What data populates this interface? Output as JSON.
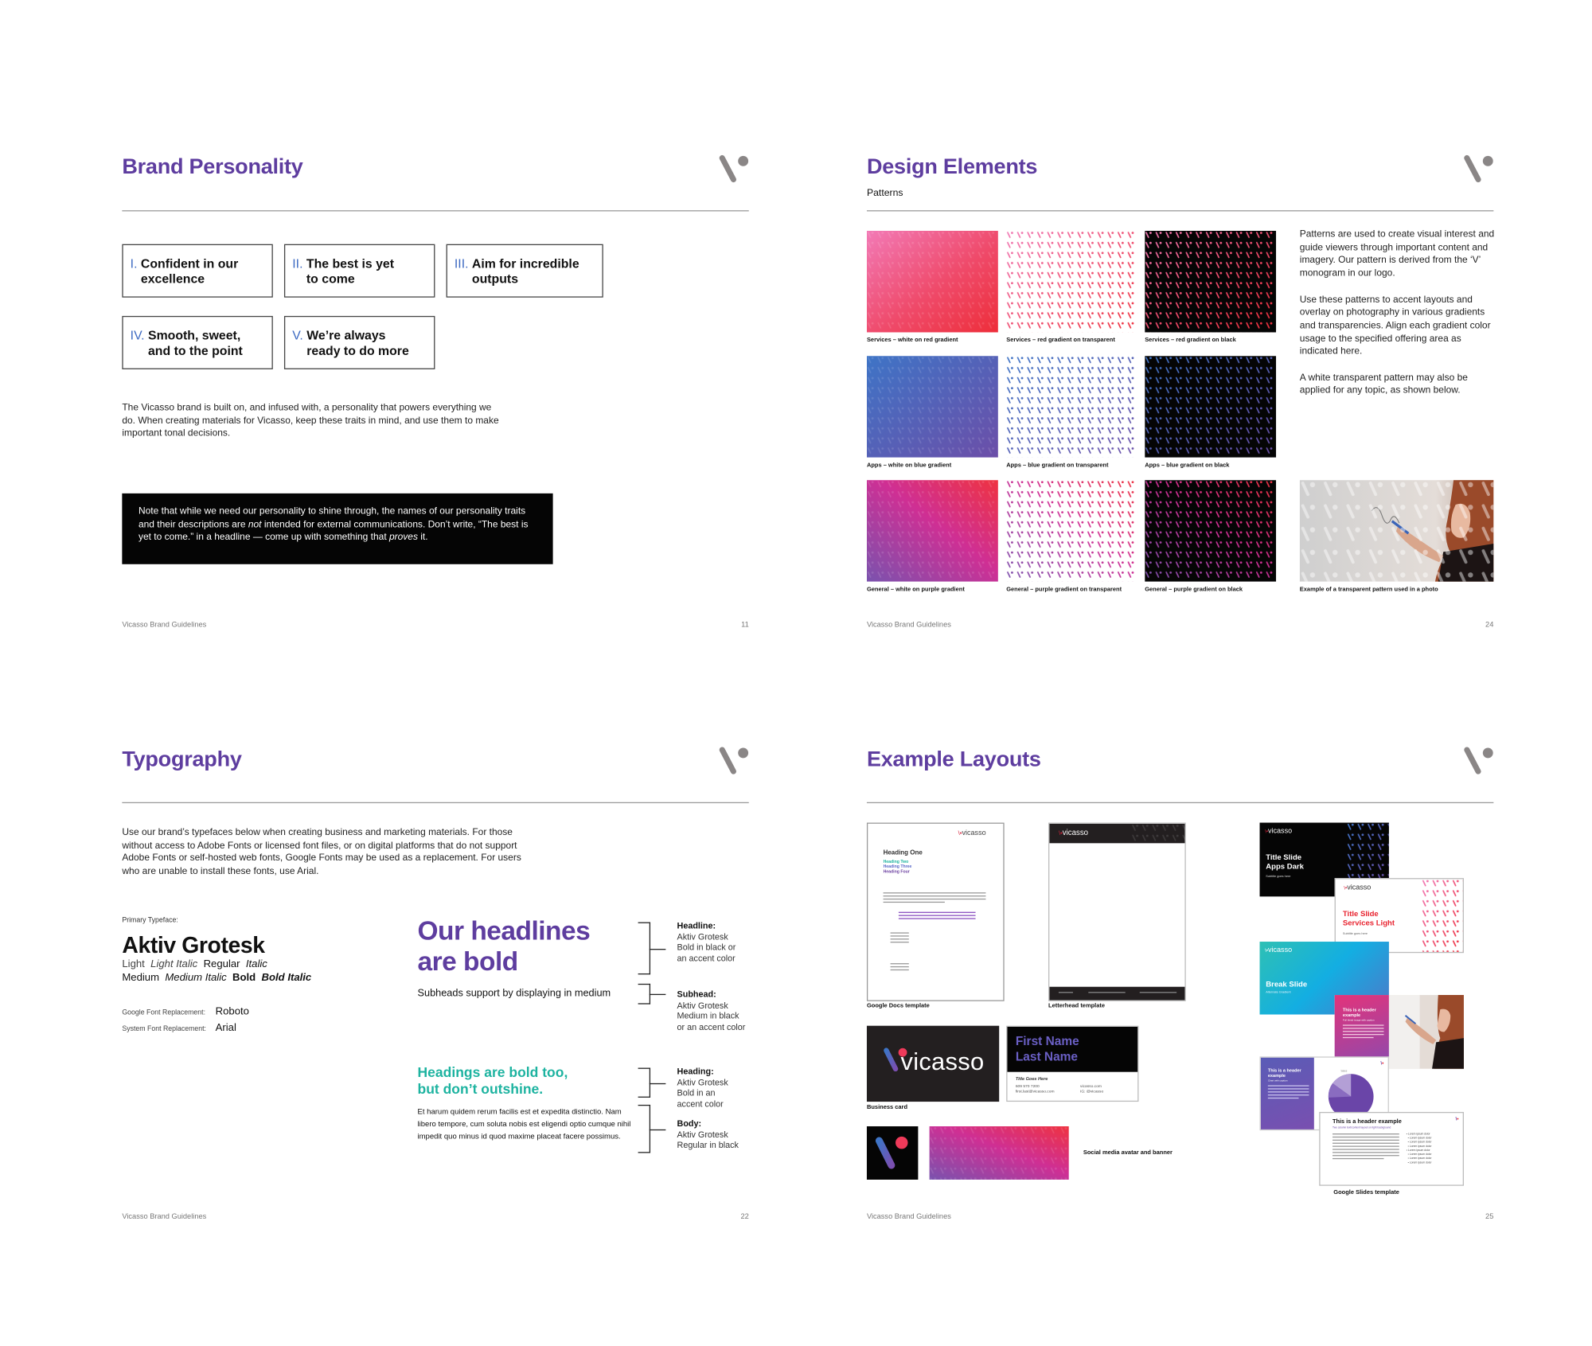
{
  "colors": {
    "accent": "#5e3d9f",
    "numeral": "#3d6ac2",
    "teal": "#1db3a0",
    "red": "#ee3342",
    "rule": "#9a9a9a",
    "monogram": "#8a8686"
  },
  "logo_icon": "vicasso-v-monogram",
  "footer_label": "Vicasso Brand Guidelines",
  "brand_personality": {
    "title": "Brand Personality",
    "page_number": "11",
    "traits": [
      {
        "numeral": "I.",
        "text": [
          "Confident in our",
          "excellence"
        ]
      },
      {
        "numeral": "II.",
        "text": [
          "The best is yet",
          "to come"
        ]
      },
      {
        "numeral": "III.",
        "text": [
          "Aim for incredible",
          "outputs"
        ]
      },
      {
        "numeral": "IV.",
        "text": [
          "Smooth, sweet,",
          "and to the point"
        ]
      },
      {
        "numeral": "V.",
        "text": [
          "We’re always",
          "ready to do more"
        ]
      }
    ],
    "intro": "The Vicasso brand is built on, and infused with, a personality that powers everything we do. When creating materials for Vicasso, keep these traits in mind, and use them to make important tonal decisions.",
    "note": {
      "part1": "Note that while we need our personality to shine through, the names of our personality traits and their descriptions are ",
      "em1": "not",
      "part2": " intended for external communications. Don’t write, “The best is yet to come.” in a headline — come up with something that ",
      "em2": "proves",
      "part3": " it."
    }
  },
  "design_elements": {
    "title": "Design Elements",
    "subtitle": "Patterns",
    "page_number": "24",
    "patterns": [
      {
        "caption": "Services – white on red gradient",
        "style": "white-on-gradient",
        "gradient": "red"
      },
      {
        "caption": "Services – red gradient on transparent",
        "style": "gradient-on-transparent",
        "gradient": "red"
      },
      {
        "caption": "Services – red gradient on black",
        "style": "gradient-on-black",
        "gradient": "red"
      },
      {
        "caption": "Apps – white on blue gradient",
        "style": "white-on-gradient",
        "gradient": "blue"
      },
      {
        "caption": "Apps – blue gradient on transparent",
        "style": "gradient-on-transparent",
        "gradient": "blue"
      },
      {
        "caption": "Apps – blue gradient on black",
        "style": "gradient-on-black",
        "gradient": "blue"
      },
      {
        "caption": "General – white on purple gradient",
        "style": "white-on-gradient",
        "gradient": "purple"
      },
      {
        "caption": "General – purple gradient on transparent",
        "style": "gradient-on-transparent",
        "gradient": "purple"
      },
      {
        "caption": "General – purple gradient on black",
        "style": "gradient-on-black",
        "gradient": "purple"
      }
    ],
    "description": [
      "Patterns are used to create visual interest and guide viewers through important content and imagery. Our pattern is derived from the ‘V’ monogram in our logo.",
      "Use these patterns to accent layouts and overlay on photography in various gradients and transparencies. Align each gradient color usage to the specified offering area as indicated here.",
      "A white transparent pattern may also be applied for any topic, as shown below."
    ],
    "photo_caption": "Example of a transparent pattern used in a photo"
  },
  "typography": {
    "title": "Typography",
    "page_number": "22",
    "intro": "Use our brand’s typefaces below when creating business and marketing materials. For those without access to Adobe Fonts or licensed font files, or on digital platforms that do not support Adobe Fonts or self-hosted web fonts, Google Fonts may be used as a replacement. For users who are unable to install these fonts, use Arial.",
    "primary_label": "Primary Typeface:",
    "primary_name": "Aktiv Grotesk",
    "weights_line1": [
      "Light",
      "Light Italic",
      "Regular",
      "Italic"
    ],
    "weights_line2": [
      "Medium",
      "Medium Italic",
      "Bold",
      "Bold Italic"
    ],
    "google_label": "Google Font Replacement:",
    "google_value": "Roboto",
    "system_label": "System Font Replacement:",
    "system_value": "Arial",
    "headline_sample": [
      "Our headlines",
      "are bold"
    ],
    "subhead_sample": "Subheads support by displaying in medium",
    "heading_sample": [
      "Headings are bold too,",
      "but don’t outshine."
    ],
    "body_sample": "Et harum quidem rerum facilis est et expedita distinctio. Nam libero tempore, cum soluta nobis est eligendi optio cumque nihil impedit quo minus id quod maxime placeat facere possimus.",
    "annotations": [
      {
        "label": "Headline:",
        "lines": [
          "Aktiv Grotesk",
          "Bold in black or",
          "an accent color"
        ]
      },
      {
        "label": "Subhead:",
        "lines": [
          "Aktiv Grotesk",
          "Medium in black",
          "or an accent color"
        ]
      },
      {
        "label": "Heading:",
        "lines": [
          "Aktiv Grotesk",
          "Bold in an",
          "accent color"
        ]
      },
      {
        "label": "Body:",
        "lines": [
          "Aktiv Grotesk",
          "Regular in black"
        ]
      }
    ]
  },
  "example_layouts": {
    "title": "Example Layouts",
    "page_number": "25",
    "wordmark": "vicasso",
    "docs": {
      "caption": "Google Docs template",
      "h1": "Heading One",
      "h2": "Heading Two",
      "h3": "Heading Three",
      "h4": "Heading Four"
    },
    "letterhead": {
      "caption": "Letterhead template"
    },
    "business_card": {
      "caption": "Business card",
      "first": "First Name",
      "last": "Last Name",
      "title": "Title Goes Here",
      "phone": "609 570 7200",
      "email": "first.last@vicasso.com",
      "web": "vicasso.com",
      "ig": "IG: @vicasso"
    },
    "social": {
      "caption": "Social media avatar and banner"
    },
    "slides": {
      "caption": "Google Slides template",
      "dark_title": [
        "Title Slide",
        "Apps Dark"
      ],
      "dark_subtitle": "Subtitle goes here",
      "light_title": [
        "Title Slide",
        "Services Light"
      ],
      "light_subtitle": "Subtitle goes here",
      "break_title": "Break Slide",
      "break_subtitle": "Alternate Gradient",
      "header_example": [
        "This is a header",
        "example"
      ],
      "image_caption": "Full bleed image with caption",
      "chart_caption": "Chart with caption",
      "text_header": "This is a header example",
      "text_sub": "Two column text/content layout on light background",
      "bullet": "Lorem ipsum dolor"
    }
  }
}
